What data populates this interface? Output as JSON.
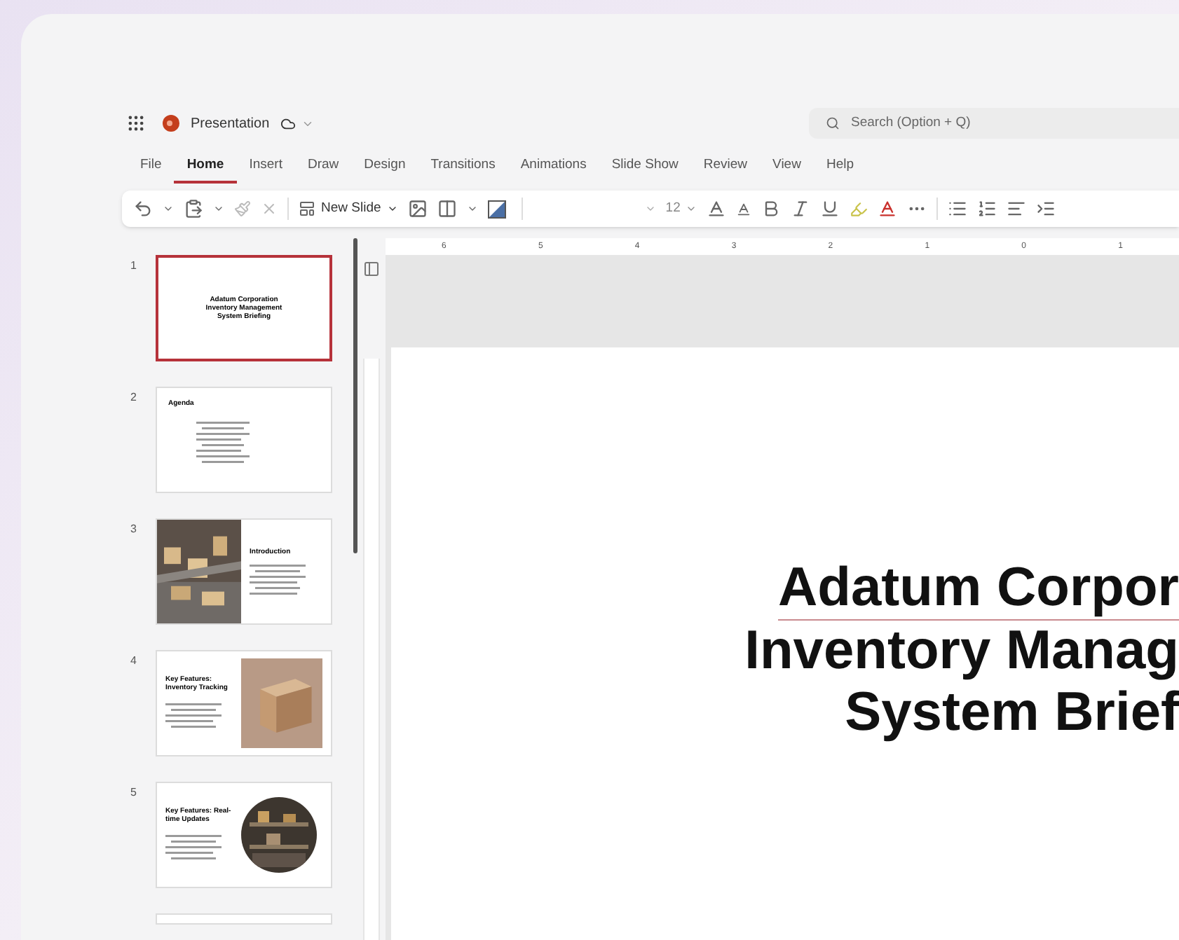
{
  "app": {
    "name": "Presentation"
  },
  "search": {
    "placeholder": "Search (Option + Q)"
  },
  "tabs": [
    {
      "label": "File",
      "selected": false
    },
    {
      "label": "Home",
      "selected": true
    },
    {
      "label": "Insert",
      "selected": false
    },
    {
      "label": "Draw",
      "selected": false
    },
    {
      "label": "Design",
      "selected": false
    },
    {
      "label": "Transitions",
      "selected": false
    },
    {
      "label": "Animations",
      "selected": false
    },
    {
      "label": "Slide Show",
      "selected": false
    },
    {
      "label": "Review",
      "selected": false
    },
    {
      "label": "View",
      "selected": false
    },
    {
      "label": "Help",
      "selected": false
    }
  ],
  "toolbar": {
    "new_slide": "New Slide",
    "font_size": "12"
  },
  "ruler": [
    "6",
    "5",
    "4",
    "3",
    "2",
    "1",
    "0",
    "1"
  ],
  "slides": [
    {
      "number": "1",
      "kind": "title",
      "title": "Adatum Corporation Inventory Management System Briefing",
      "selected": true
    },
    {
      "number": "2",
      "kind": "agenda",
      "title": "Agenda",
      "selected": false
    },
    {
      "number": "3",
      "kind": "image-left",
      "title": "Introduction",
      "selected": false
    },
    {
      "number": "4",
      "kind": "image-right",
      "title": "Key Features: Inventory Tracking",
      "selected": false
    },
    {
      "number": "5",
      "kind": "image-circle",
      "title": "Key Features: Real-time Updates",
      "selected": false
    },
    {
      "kind": "partial",
      "selected": false
    }
  ],
  "slide_title": [
    "Adatum Corpor",
    "Inventory Manag",
    "System Brief"
  ]
}
